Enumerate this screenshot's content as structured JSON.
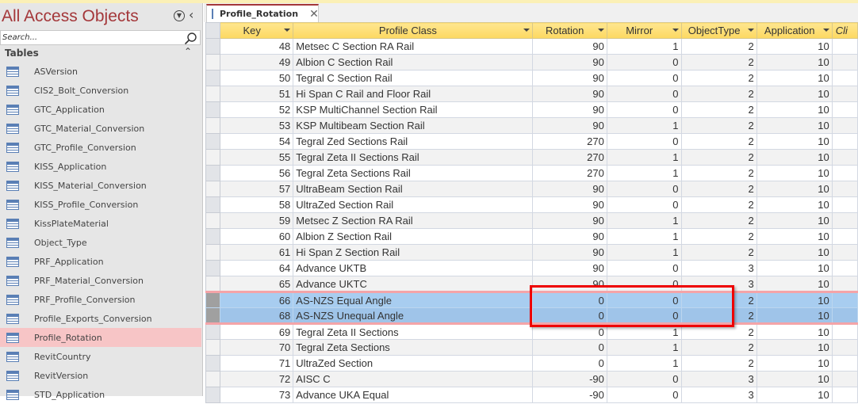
{
  "nav": {
    "title": "All Access Objects",
    "search_placeholder": "Search...",
    "section": "Tables",
    "items": [
      "ASVersion",
      "CIS2_Bolt_Conversion",
      "GTC_Application",
      "GTC_Material_Conversion",
      "GTC_Profile_Conversion",
      "KISS_Application",
      "KISS_Material_Conversion",
      "KISS_Profile_Conversion",
      "KissPlateMaterial",
      "Object_Type",
      "PRF_Application",
      "PRF_Material_Conversion",
      "PRF_Profile_Conversion",
      "Profile_Exports_Conversion",
      "Profile_Rotation",
      "RevitCountry",
      "RevitVersion",
      "STD_Application"
    ],
    "selected": "Profile_Rotation"
  },
  "tab": {
    "label": "Profile_Rotation",
    "close": "✕"
  },
  "columns": [
    "Key",
    "Profile Class",
    "Rotation",
    "Mirror",
    "ObjectType",
    "Application",
    "Cli"
  ],
  "rows": [
    [
      "48",
      "Metsec C Section RA Rail",
      "90",
      "1",
      "2",
      "10"
    ],
    [
      "49",
      "Albion C Section Rail",
      "90",
      "0",
      "2",
      "10"
    ],
    [
      "50",
      "Tegral C Section Rail",
      "90",
      "0",
      "2",
      "10"
    ],
    [
      "51",
      "Hi Span C Rail and Floor Rail",
      "90",
      "0",
      "2",
      "10"
    ],
    [
      "52",
      "KSP MultiChannel Section Rail",
      "90",
      "0",
      "2",
      "10"
    ],
    [
      "53",
      "KSP Multibeam Section Rail",
      "90",
      "1",
      "2",
      "10"
    ],
    [
      "54",
      "Tegral Zed Sections Rail",
      "270",
      "0",
      "2",
      "10"
    ],
    [
      "55",
      "Tegral Zeta II Sections Rail",
      "270",
      "1",
      "2",
      "10"
    ],
    [
      "56",
      "Tegral Zeta Sections Rail",
      "270",
      "1",
      "2",
      "10"
    ],
    [
      "57",
      "UltraBeam Section Rail",
      "90",
      "0",
      "2",
      "10"
    ],
    [
      "58",
      "UltraZed Section Rail",
      "90",
      "0",
      "2",
      "10"
    ],
    [
      "59",
      "Metsec Z Section RA Rail",
      "90",
      "1",
      "2",
      "10"
    ],
    [
      "60",
      "Albion Z Section Rail",
      "90",
      "1",
      "2",
      "10"
    ],
    [
      "61",
      "Hi Span Z Section Rail",
      "90",
      "1",
      "2",
      "10"
    ],
    [
      "64",
      "Advance UKTB",
      "90",
      "0",
      "3",
      "10"
    ],
    [
      "65",
      "Advance UKTC",
      "90",
      "0",
      "3",
      "10"
    ],
    [
      "66",
      "AS-NZS Equal Angle",
      "0",
      "0",
      "2",
      "10"
    ],
    [
      "68",
      "AS-NZS Unequal Angle",
      "0",
      "0",
      "2",
      "10"
    ],
    [
      "69",
      "Tegral Zeta II Sections",
      "0",
      "1",
      "2",
      "10"
    ],
    [
      "70",
      "Tegral Zeta Sections",
      "0",
      "1",
      "2",
      "10"
    ],
    [
      "71",
      "UltraZed Section",
      "0",
      "1",
      "2",
      "10"
    ],
    [
      "72",
      "AISC C",
      "-90",
      "0",
      "3",
      "10"
    ],
    [
      "73",
      "Advance UKA Equal",
      "-90",
      "0",
      "3",
      "10"
    ]
  ],
  "highlighted_keys": [
    "66",
    "68"
  ]
}
